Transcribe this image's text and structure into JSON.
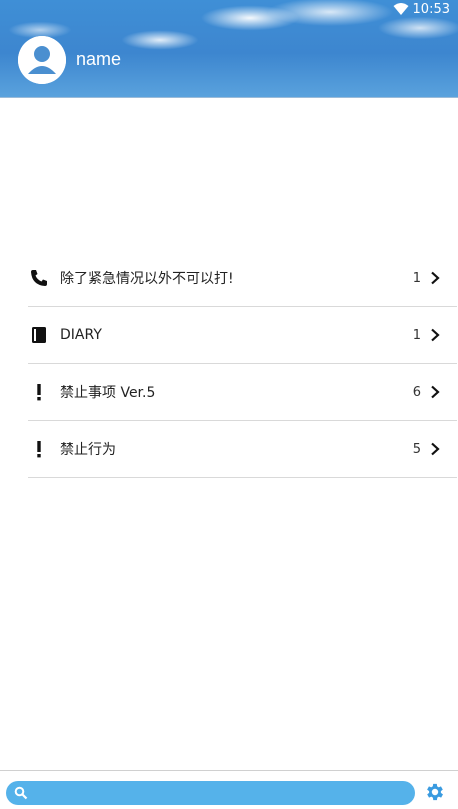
{
  "status": {
    "time": "10:53"
  },
  "profile": {
    "name": "name"
  },
  "menu": {
    "items": [
      {
        "label": "除了紧急情况以外不可以打!",
        "count": "1",
        "icon": "phone-icon"
      },
      {
        "label": "DIARY",
        "count": "1",
        "icon": "book-icon"
      },
      {
        "label": "禁止事项 Ver.5",
        "count": "6",
        "icon": "exclamation-icon"
      },
      {
        "label": "禁止行为",
        "count": "5",
        "icon": "exclamation-icon"
      }
    ]
  },
  "search": {
    "placeholder": "",
    "value": ""
  },
  "colors": {
    "accent": "#55b2ea",
    "settings": "#3a9be0"
  }
}
